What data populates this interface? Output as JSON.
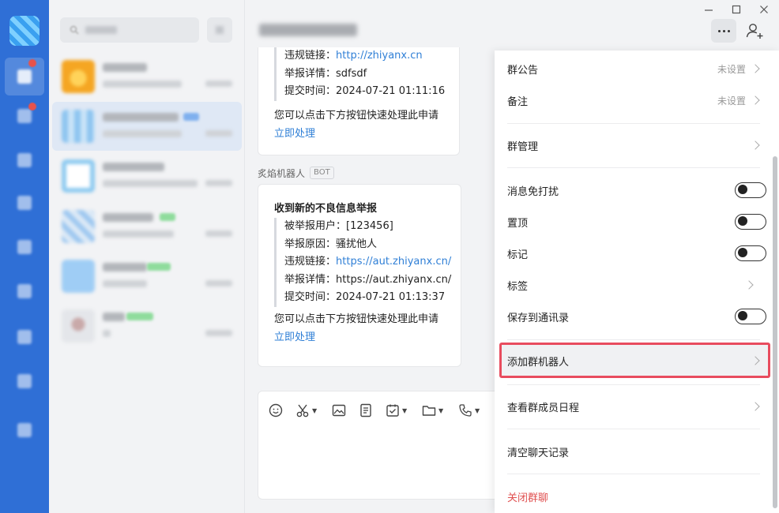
{
  "window": {
    "minimize_glyph": "—",
    "maximize_glyph": "☐",
    "close_glyph": "✕"
  },
  "chat": {
    "card1": {
      "rows": [
        {
          "label": "违规链接：",
          "value": "http://zhiyanx.cn",
          "is_link": true
        },
        {
          "label": "举报详情：",
          "value": "sdfsdf",
          "is_link": false
        },
        {
          "label": "提交时间：",
          "value": "2024-07-21 01:11:16",
          "is_link": false
        }
      ],
      "tip": "您可以点击下方按钮快速处理此申请",
      "action": "立即处理"
    },
    "sender": {
      "name": "炙焰机器人",
      "badge": "BOT"
    },
    "card2": {
      "heading": "收到新的不良信息举报",
      "rows": [
        {
          "label": "被举报用户：",
          "value": "[123456]",
          "is_link": false
        },
        {
          "label": "举报原因：",
          "value": "骚扰他人",
          "is_link": false
        },
        {
          "label": "违规链接：",
          "value": "https://aut.zhiyanx.cn/",
          "is_link": true
        },
        {
          "label": "举报详情：",
          "value": "https://aut.zhiyanx.cn/",
          "is_link": false
        },
        {
          "label": "提交时间：",
          "value": "2024-07-21 01:13:37",
          "is_link": false
        }
      ],
      "tip": "您可以点击下方按钮快速处理此申请",
      "action": "立即处理"
    },
    "toolbar": [
      "emoji-icon",
      "scissors-icon",
      "image-icon",
      "document-icon",
      "task-icon",
      "folder-icon",
      "phone-icon"
    ]
  },
  "drawer": {
    "group_notice": {
      "label": "群公告",
      "hint": "未设置"
    },
    "remark": {
      "label": "备注",
      "hint": "未设置"
    },
    "group_manage": {
      "label": "群管理"
    },
    "mute": {
      "label": "消息免打扰",
      "on": false
    },
    "pin": {
      "label": "置顶",
      "on": false
    },
    "mark": {
      "label": "标记",
      "on": false
    },
    "tags": {
      "label": "标签"
    },
    "save_contacts": {
      "label": "保存到通讯录",
      "on": false
    },
    "add_bot": {
      "label": "添加群机器人"
    },
    "member_schedule": {
      "label": "查看群成员日程"
    },
    "clear_history": {
      "label": "清空聊天记录"
    },
    "close_group": {
      "label": "关闭群聊"
    }
  },
  "colors": {
    "rail": "#2f6fd6",
    "link": "#2f7fd6",
    "highlight_border": "#e84c5e",
    "danger": "#e05050"
  }
}
